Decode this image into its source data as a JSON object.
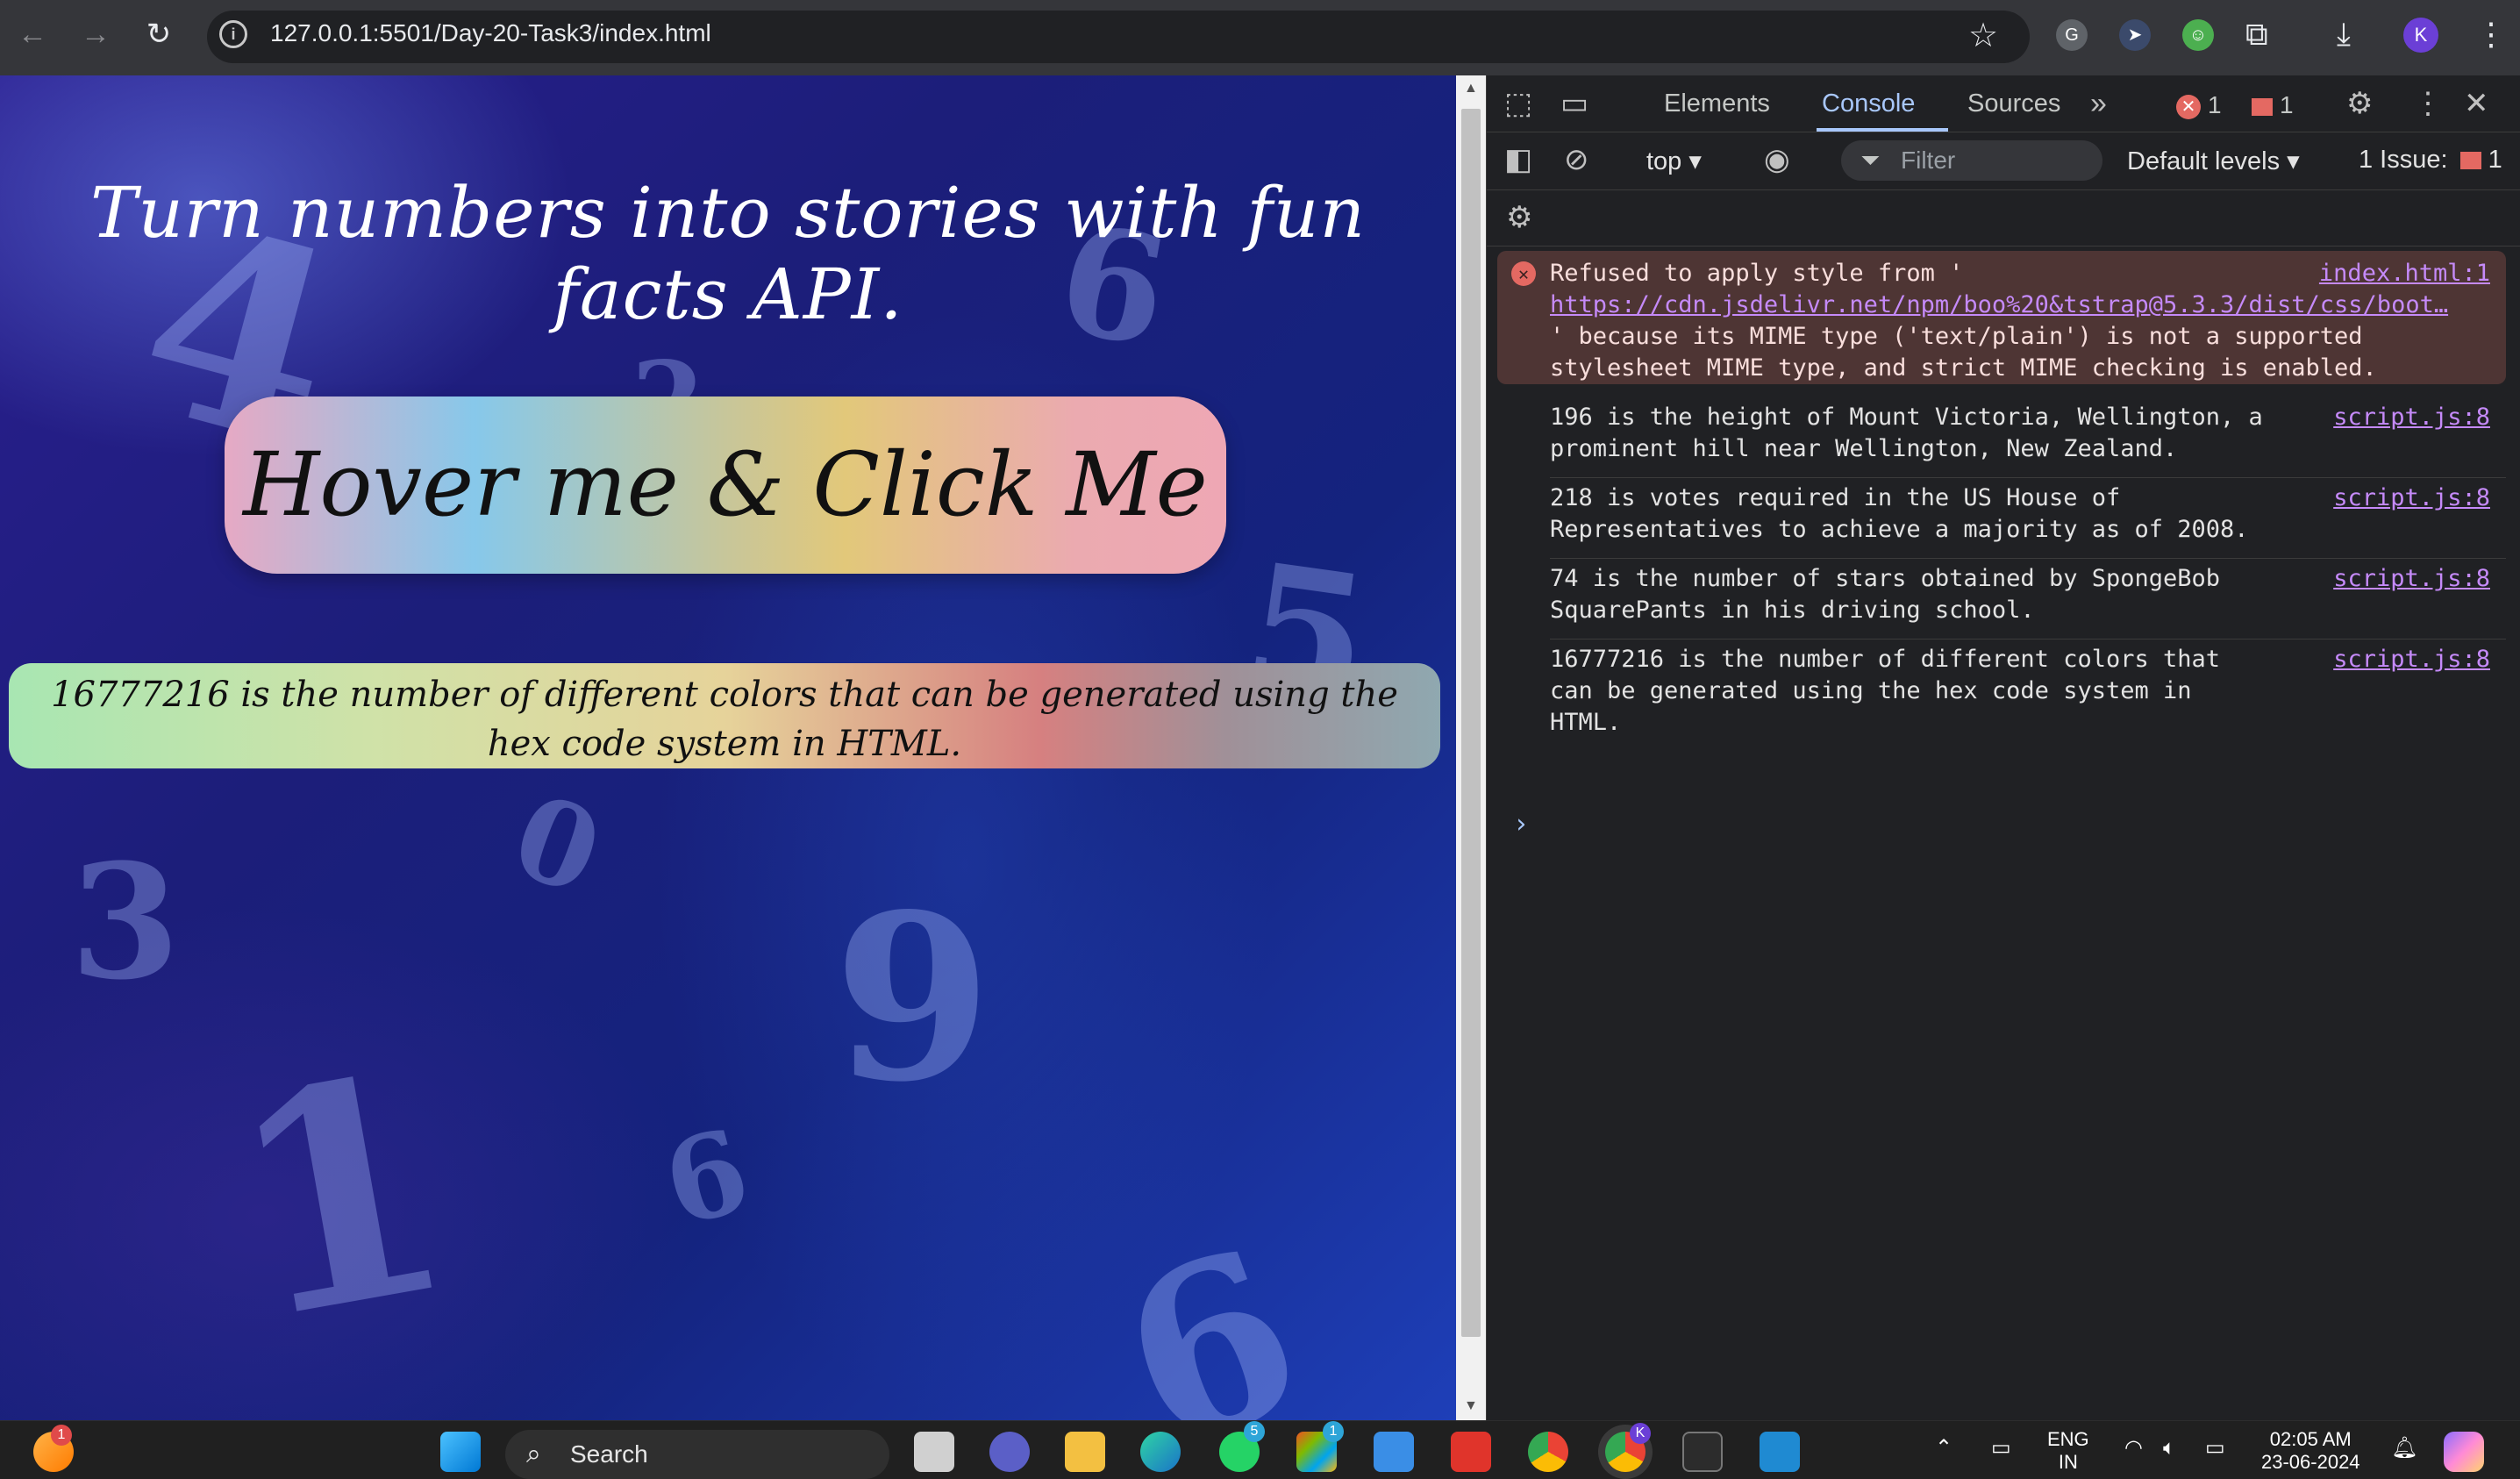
{
  "browser": {
    "url": "127.0.0.1:5501/Day-20-Task3/index.html",
    "profile_initial": "K"
  },
  "page": {
    "headline": "Turn numbers into stories with fun facts API.",
    "button_label": "Hover me &  Click Me",
    "fact_text": "16777216 is the number of different colors that can be generated using the hex code system in HTML.",
    "background_numbers": [
      "4",
      "2",
      "6",
      "5",
      "3",
      "0",
      "9",
      "1",
      "6",
      "6"
    ]
  },
  "devtools": {
    "tabs": [
      "Elements",
      "Console",
      "Sources"
    ],
    "active_tab": "Console",
    "error_count": "1",
    "issue_count": "1",
    "context": "top",
    "filter_placeholder": "Filter",
    "levels": "Default levels",
    "issues_label": "1 Issue:",
    "issues_count": "1",
    "messages": [
      {
        "type": "error",
        "text_before": "Refused to apply style from '",
        "link": "https://cdn.jsdelivr.net/npm/boo%20&tstrap@5.3.3/dist/css/boot…",
        "text_after": "' because its MIME type ('text/plain') is not a supported stylesheet MIME type, and strict MIME checking is enabled.",
        "source": "index.html:1"
      },
      {
        "type": "log",
        "text": "196 is the height of Mount Victoria, Wellington, a prominent hill near Wellington, New Zealand.",
        "source": "script.js:8"
      },
      {
        "type": "log",
        "text": "218 is votes required in the US House of Representatives to achieve a majority as of 2008.",
        "source": "script.js:8"
      },
      {
        "type": "log",
        "text": "74 is the number of stars obtained by SpongeBob SquarePants in his driving school.",
        "source": "script.js:8"
      },
      {
        "type": "log",
        "text": "16777216 is the number of different colors that can be generated using the hex code system in HTML.",
        "source": "script.js:8"
      }
    ]
  },
  "taskbar": {
    "search_placeholder": "Search",
    "language_line1": "ENG",
    "language_line2": "IN",
    "time": "02:05 AM",
    "date": "23-06-2024",
    "badges": {
      "widgets": "1",
      "whatsapp": "5",
      "store": "1",
      "chrome_profile": "K"
    }
  },
  "colors": {
    "accent": "#a8c7fa",
    "error": "#e46962",
    "link": "#c58af9"
  }
}
